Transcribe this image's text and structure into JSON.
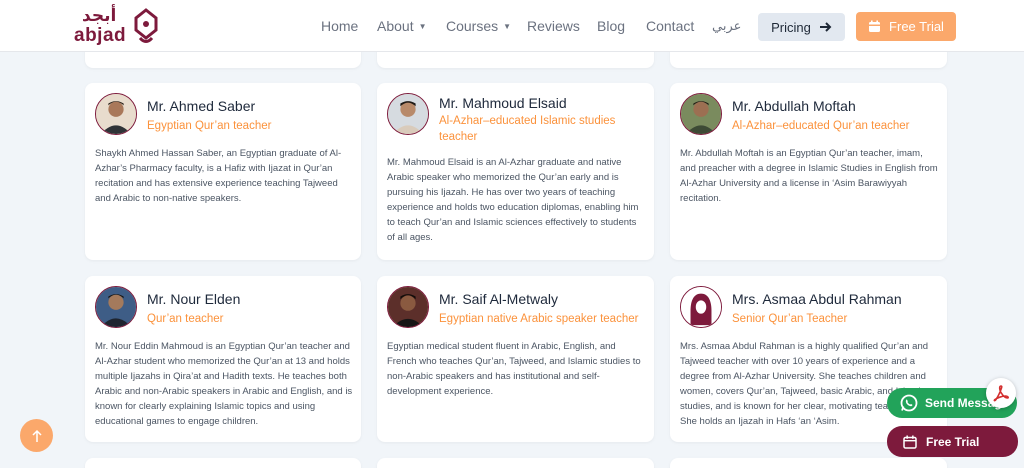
{
  "header": {
    "logo_en": "abjad",
    "logo_ar": "أبجد",
    "nav": [
      {
        "label": "Home",
        "has_caret": false
      },
      {
        "label": "About",
        "has_caret": true
      },
      {
        "label": "Courses",
        "has_caret": true
      },
      {
        "label": "Reviews",
        "has_caret": false
      },
      {
        "label": "Blog",
        "has_caret": false
      },
      {
        "label": "Contact",
        "has_caret": false
      },
      {
        "label": "عربي",
        "has_caret": false
      }
    ],
    "pricing_label": "Pricing",
    "trial_label": "Free Trial"
  },
  "teachers": [
    {
      "name": "Mr. Ahmed Saber",
      "role": "Egyptian Qur’an teacher",
      "bio": "Shaykh Ahmed Hassan Saber, an Egyptian graduate of Al-Azhar’s Pharmacy faculty, is a Hafiz with Ijazat in Qur’an recitation and has extensive experience teaching Tajweed and Arabic to non-native speakers."
    },
    {
      "name": "Mr. Mahmoud Elsaid",
      "role": "Al-Azhar–educated Islamic studies teacher",
      "bio": "Mr. Mahmoud Elsaid is an Al-Azhar graduate and native Arabic speaker who memorized the Qur’an early and is pursuing his Ijazah. He has over two years of teaching experience and holds two education diplomas, enabling him to teach Qur’an and Islamic sciences effectively to students of all ages."
    },
    {
      "name": "Mr. Abdullah Moftah",
      "role": "Al-Azhar–educated Qur’an teacher",
      "bio": "Mr. Abdullah Moftah is an Egyptian Qur’an teacher, imam, and preacher with a degree in Islamic Studies in English from Al-Azhar University and a license in ‘Asim Barawiyyah recitation."
    },
    {
      "name": "Mr. Nour Elden",
      "role": "Qur’an teacher",
      "bio": "Mr. Nour Eddin Mahmoud is an Egyptian Qur’an teacher and Al-Azhar student who memorized the Qur’an at 13 and holds multiple Ijazahs in Qira’at and Hadith texts. He teaches both Arabic and non-Arabic speakers in Arabic and English, and is known for clearly explaining Islamic topics and using educational games to engage children."
    },
    {
      "name": "Mr. Saif Al-Metwaly",
      "role": "Egyptian native Arabic speaker teacher",
      "bio": "Egyptian medical student fluent in Arabic, English, and French who teaches Qur’an, Tajweed, and Islamic studies to non-Arabic speakers and has institutional and self-development experience."
    },
    {
      "name": "Mrs. Asmaa Abdul Rahman",
      "role": "Senior Qur’an Teacher",
      "bio": "Mrs. Asmaa Abdul Rahman is a highly qualified Qur’an and Tajweed teacher with over 10 years of experience and a degree from Al-Azhar University. She teaches children and women, covers Qur’an, Tajweed, basic Arabic, and Islamic studies, and is known for her clear, motivating teaching style. She holds an Ijazah in Hafs ‘an ‘Asim."
    }
  ],
  "floating": {
    "whatsapp_label": "Send Message",
    "free_trial_label": "Free Trial"
  },
  "colors": {
    "brand": "#7d1a3c",
    "accent": "#fba86b",
    "whatsapp": "#22a35a",
    "role_text": "#fb923c"
  }
}
